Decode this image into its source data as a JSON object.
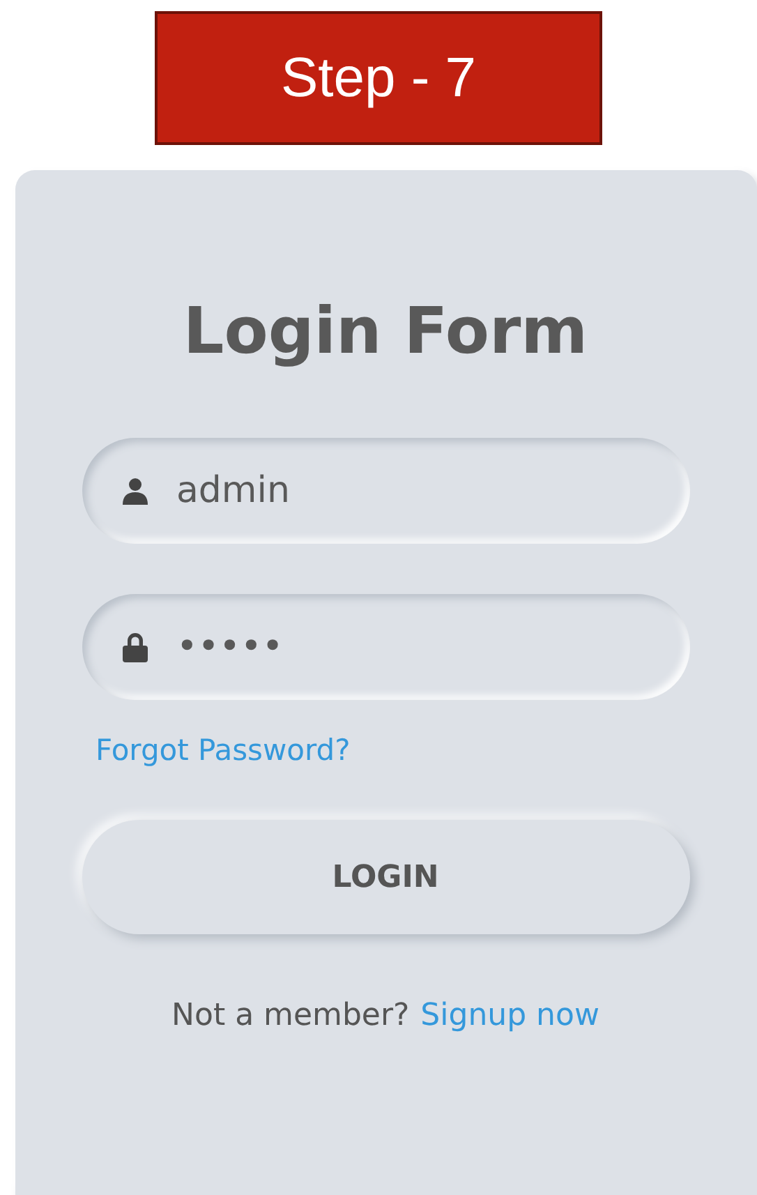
{
  "banner": {
    "text": "Step - 7"
  },
  "form": {
    "title": "Login Form",
    "fields": [
      {
        "kind": "user",
        "value": "admin"
      },
      {
        "kind": "lock",
        "value": "•••••"
      }
    ],
    "forgot_link": "Forgot Password?",
    "login_button": "LOGIN",
    "signup": {
      "prompt": "Not a member?",
      "link": "Signup now"
    }
  }
}
